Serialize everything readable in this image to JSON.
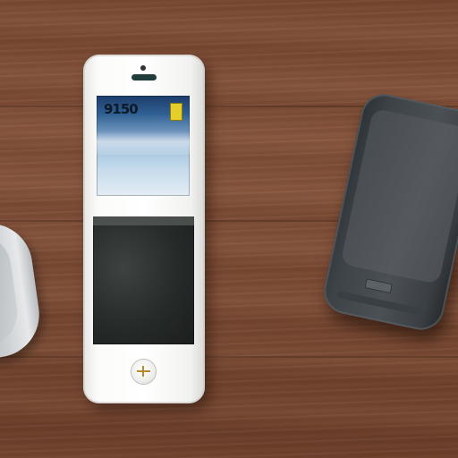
{
  "scene": {
    "description_items": [
      "left-phone",
      "white-phone",
      "dark-phone"
    ]
  },
  "white_phone": {
    "screen_text": "9150"
  },
  "colors": {
    "table": "#7a4a33",
    "white_phone_body": "#ffffff",
    "dark_phone_body": "#3e4347",
    "left_phone_body": "#c9cdd0",
    "home_button_mark": "#b68b2c"
  }
}
